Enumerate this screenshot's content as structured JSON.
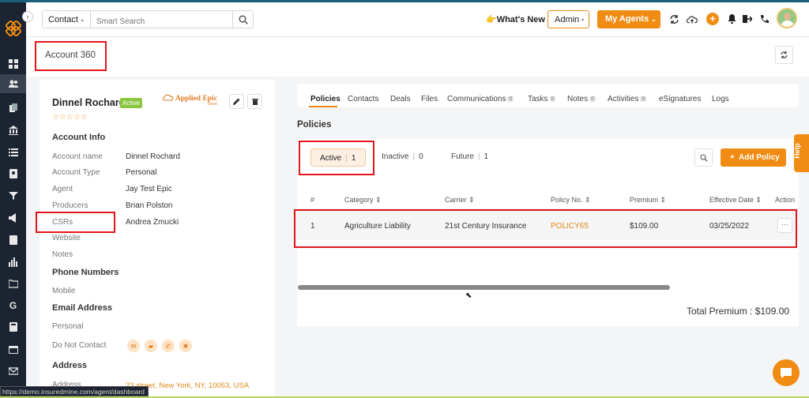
{
  "topbar": {
    "contact_select": "Contact",
    "search_placeholder": "Smart Search",
    "whats_new": "👉What's New",
    "admin_label": "Admin",
    "my_agents_label": "My Agents"
  },
  "page": {
    "title": "Account 360"
  },
  "account": {
    "name": "Dinnel Rochard",
    "status": "Active",
    "rating_stars": "☆☆☆☆☆",
    "integration_logo_text": "Applied Epic",
    "integration_logo_sub": "Store",
    "sections": {
      "account_info": "Account Info",
      "phone_numbers": "Phone Numbers",
      "email_address": "Email Address",
      "address": "Address"
    },
    "fields": [
      {
        "label": "Account name",
        "value": "Dinnel Rochard"
      },
      {
        "label": "Account Type",
        "value": "Personal"
      },
      {
        "label": "Agent",
        "value": "Jay Test Epic"
      },
      {
        "label": "Producers",
        "value": "Brian Polston"
      },
      {
        "label": "CSRs",
        "value": "Andrea Zmucki"
      },
      {
        "label": "Website",
        "value": ""
      },
      {
        "label": "Notes",
        "value": ""
      }
    ],
    "mobile_label": "Mobile",
    "personal_label": "Personal",
    "do_not_contact_label": "Do Not Contact",
    "address_label": "Address",
    "address_value": "23 street, New York, NY, 10053, USA"
  },
  "tabs": [
    {
      "label": "Policies"
    },
    {
      "label": "Contacts"
    },
    {
      "label": "Deals"
    },
    {
      "label": "Files"
    },
    {
      "label": "Communications",
      "count": "0"
    },
    {
      "label": "Tasks",
      "count": "0"
    },
    {
      "label": "Notes",
      "count": "0"
    },
    {
      "label": "Activities",
      "count": "0"
    },
    {
      "label": "eSignatures"
    },
    {
      "label": "Logs"
    }
  ],
  "policies": {
    "title": "Policies",
    "filters": [
      {
        "label": "Active",
        "count": "1"
      },
      {
        "label": "Inactive",
        "count": "0"
      },
      {
        "label": "Future",
        "count": "1"
      }
    ],
    "add_button": "Add Policy",
    "columns": [
      "#",
      "Category",
      "Carrier",
      "Policy No.",
      "Premium",
      "Effective Date",
      "Action"
    ],
    "rows": [
      {
        "num": "1",
        "category": "Agriculture Liability",
        "carrier": "21st Century Insurance",
        "policy_no": "POLICY65",
        "premium": "$109.00",
        "effective_date": "03/25/2022"
      }
    ],
    "total_premium": "Total Premium : $109.00"
  },
  "help_label": "Help",
  "status_url": "https://demo.insuredmine.com/agent/dashboard",
  "colors": {
    "accent": "#f08c13",
    "sidebar": "#1c2331",
    "highlight_box": "#e2161b",
    "active_badge": "#8ac640"
  }
}
